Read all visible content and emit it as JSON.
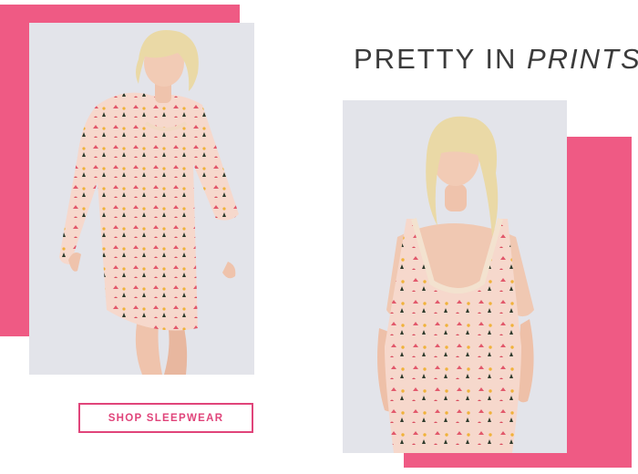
{
  "headline": {
    "regular": "PRETTY IN",
    "emphasis": "PRINTS"
  },
  "cta": {
    "label": "SHOP SLEEPWEAR"
  },
  "colors": {
    "accent_pink": "#ef5a84",
    "cta_pink": "#e0447a",
    "photo_bg": "#e3e4ea",
    "text_dark": "#3b3b3b"
  }
}
